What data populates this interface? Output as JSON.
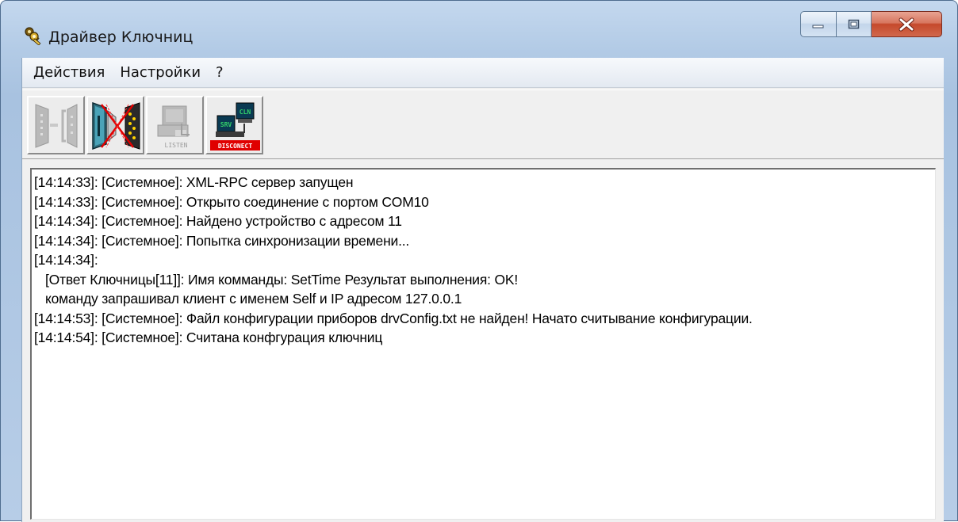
{
  "window": {
    "title": "Драйвер Ключниц"
  },
  "menu": [
    "Действия",
    "Настройки",
    "?"
  ],
  "toolbar": {
    "listen_label": "LISTEN",
    "disconnect_label": "DISCONECT",
    "cln_label": "CLN",
    "srv_label": "SRV"
  },
  "log": [
    "[14:14:33]: [Системное]: XML-RPC сервер запущен",
    "[14:14:33]: [Системное]: Открыто соединение с портом COM10",
    "[14:14:34]: [Системное]: Найдено устройство с адресом 11",
    "[14:14:34]: [Системное]: Попытка синхронизации времени...",
    "[14:14:34]:",
    "   [Ответ Ключницы[11]]: Имя комманды: SetTime Результат выполнения: OK!",
    "   команду запрашивал клиент с именем Self и IP адресом 127.0.0.1",
    "[14:14:53]: [Системное]: Файл конфигурации приборов drvConfig.txt не найден! Начато считывание конфигурации.",
    "[14:14:54]: [Системное]: Считана конфгурация ключниц"
  ],
  "colors": {
    "close_button": "#c5492c",
    "disconnect_red": "#e00000",
    "terminal_bg": "#0a3a52",
    "terminal_text": "#33d06a"
  }
}
